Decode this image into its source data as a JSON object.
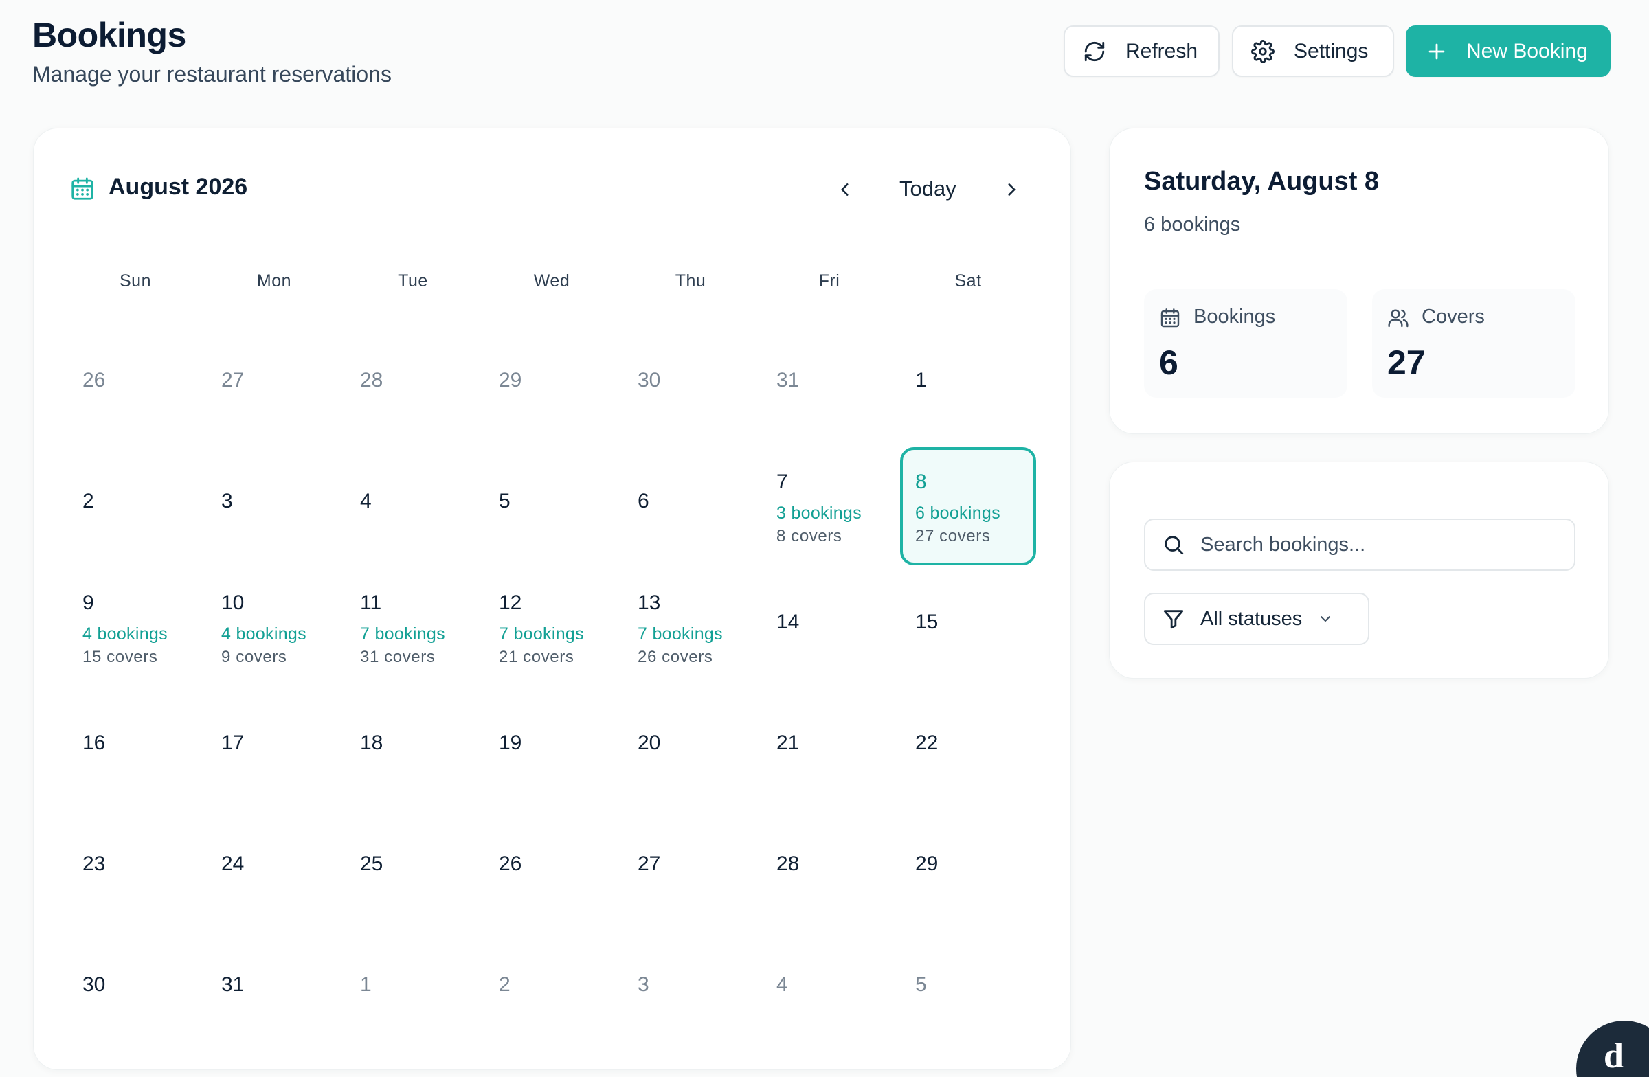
{
  "header": {
    "title": "Bookings",
    "subtitle": "Manage your restaurant reservations",
    "refresh_label": "Refresh",
    "settings_label": "Settings",
    "new_booking_label": "New Booking"
  },
  "calendar": {
    "month_label": "August 2026",
    "today_label": "Today",
    "weekdays": [
      "Sun",
      "Mon",
      "Tue",
      "Wed",
      "Thu",
      "Fri",
      "Sat"
    ],
    "selected_day": "8",
    "weeks": [
      [
        {
          "day": "26",
          "muted": true
        },
        {
          "day": "27",
          "muted": true
        },
        {
          "day": "28",
          "muted": true
        },
        {
          "day": "29",
          "muted": true
        },
        {
          "day": "30",
          "muted": true
        },
        {
          "day": "31",
          "muted": true
        },
        {
          "day": "1"
        }
      ],
      [
        {
          "day": "2"
        },
        {
          "day": "3"
        },
        {
          "day": "4"
        },
        {
          "day": "5"
        },
        {
          "day": "6"
        },
        {
          "day": "7",
          "bookings": "3 bookings",
          "covers": "8 covers"
        },
        {
          "day": "8",
          "bookings": "6 bookings",
          "covers": "27 covers",
          "selected": true
        }
      ],
      [
        {
          "day": "9",
          "bookings": "4 bookings",
          "covers": "15 covers"
        },
        {
          "day": "10",
          "bookings": "4 bookings",
          "covers": "9 covers"
        },
        {
          "day": "11",
          "bookings": "7 bookings",
          "covers": "31 covers"
        },
        {
          "day": "12",
          "bookings": "7 bookings",
          "covers": "21 covers"
        },
        {
          "day": "13",
          "bookings": "7 bookings",
          "covers": "26 covers"
        },
        {
          "day": "14"
        },
        {
          "day": "15"
        }
      ],
      [
        {
          "day": "16"
        },
        {
          "day": "17"
        },
        {
          "day": "18"
        },
        {
          "day": "19"
        },
        {
          "day": "20"
        },
        {
          "day": "21"
        },
        {
          "day": "22"
        }
      ],
      [
        {
          "day": "23"
        },
        {
          "day": "24"
        },
        {
          "day": "25"
        },
        {
          "day": "26"
        },
        {
          "day": "27"
        },
        {
          "day": "28"
        },
        {
          "day": "29"
        }
      ],
      [
        {
          "day": "30"
        },
        {
          "day": "31"
        },
        {
          "day": "1",
          "muted": true
        },
        {
          "day": "2",
          "muted": true
        },
        {
          "day": "3",
          "muted": true
        },
        {
          "day": "4",
          "muted": true
        },
        {
          "day": "5",
          "muted": true
        }
      ]
    ]
  },
  "summary": {
    "date_label": "Saturday, August 8",
    "bookings_count_label": "6 bookings",
    "stats": {
      "bookings_label": "Bookings",
      "bookings_value": "6",
      "covers_label": "Covers",
      "covers_value": "27"
    }
  },
  "filters": {
    "search_placeholder": "Search bookings...",
    "search_value": "",
    "status_selected": "All statuses"
  },
  "widget": {
    "letter": "d"
  },
  "colors": {
    "accent": "#1eb3a5",
    "accent_text": "#12a094",
    "text_primary": "#0c1c33",
    "text_muted": "#7b8794"
  }
}
